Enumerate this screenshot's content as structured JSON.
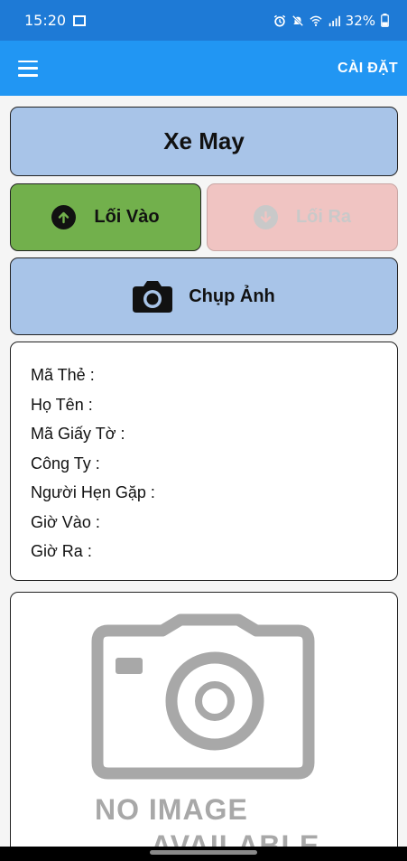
{
  "status_bar": {
    "time": "15:20",
    "battery": "32%"
  },
  "app_bar": {
    "settings_label": "CÀI ĐẶT"
  },
  "vehicle_type": "Xe May",
  "buttons": {
    "entry_label": "Lối Vào",
    "exit_label": "Lối Ra",
    "photo_label": "Chụp Ảnh"
  },
  "info": {
    "card_id_label": "Mã Thẻ :",
    "name_label": "Họ Tên :",
    "document_id_label": "Mã Giấy Tờ :",
    "company_label": "Công Ty :",
    "host_label": "Người Hẹn Gặp :",
    "time_in_label": "Giờ Vào :",
    "time_out_label": "Giờ Ra :"
  },
  "image_placeholder": {
    "line1": "NO IMAGE",
    "line2": "AVAILABLE"
  },
  "colors": {
    "status_bar": "#1e7ad6",
    "app_bar": "#2196f3",
    "title_card": "#a8c4e8",
    "entry_button": "#72b04c",
    "exit_button": "#f0c4c2"
  },
  "icons": {
    "menu": "hamburger-icon",
    "entry": "arrow-up-circle-icon",
    "exit": "arrow-down-circle-icon",
    "photo": "camera-icon",
    "placeholder": "no-image-camera-icon"
  }
}
